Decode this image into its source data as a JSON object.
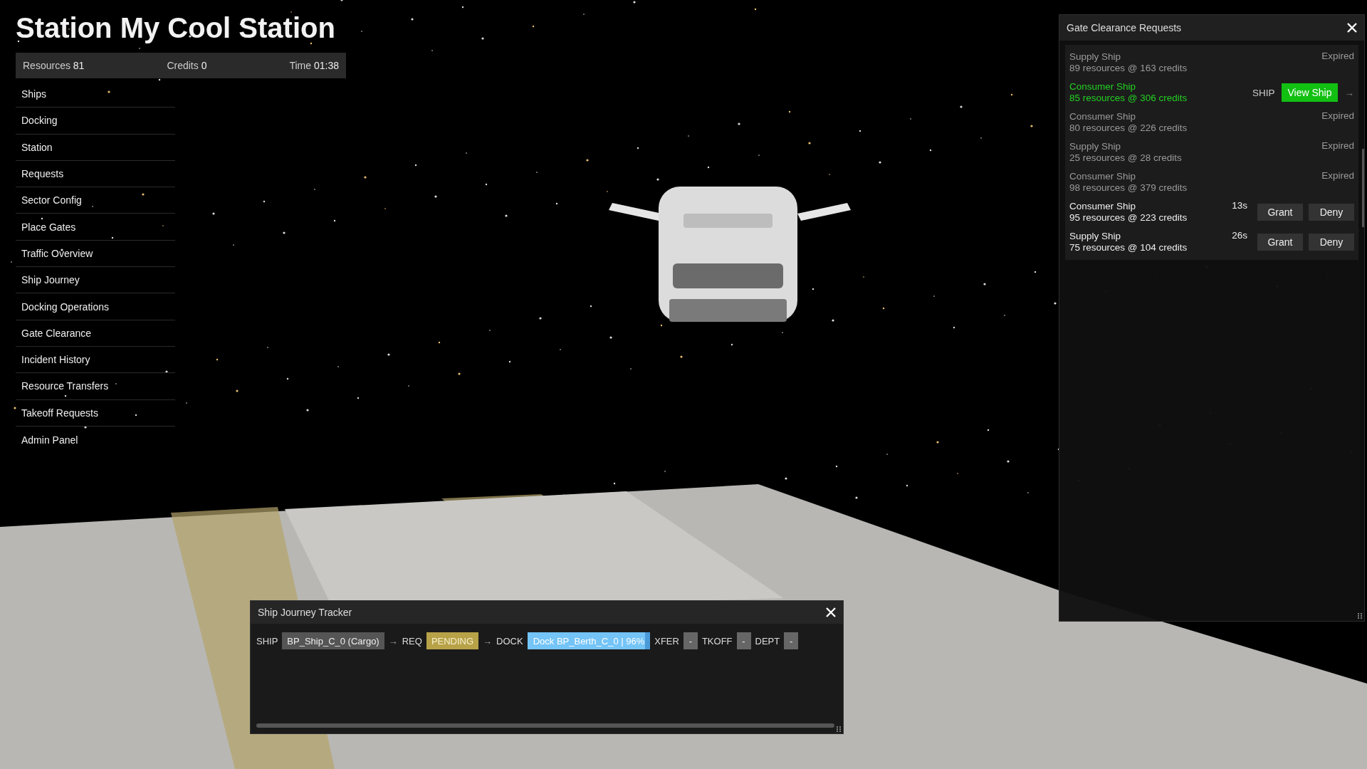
{
  "hud": {
    "title": "Station My Cool Station",
    "stats": [
      {
        "label": "Resources",
        "value": "81"
      },
      {
        "label": "Credits",
        "value": "0"
      },
      {
        "label": "Time",
        "value": "01:38"
      }
    ]
  },
  "menu": {
    "items": [
      "Ships",
      "Docking",
      "Station",
      "Requests",
      "Sector Config",
      "Place Gates",
      "Traffic Overview",
      "Ship Journey",
      "Docking Operations",
      "Gate Clearance",
      "Incident History",
      "Resource Transfers",
      "Takeoff Requests",
      "Admin Panel"
    ]
  },
  "gate_clearance": {
    "title": "Gate Clearance Requests",
    "requests": [
      {
        "kind": "expired",
        "ship": "Supply Ship",
        "detail": "89 resources @ 163 credits",
        "status": "Expired"
      },
      {
        "kind": "viewing",
        "ship": "Consumer Ship",
        "detail": "85 resources @ 306 credits",
        "tag": "SHIP",
        "button": "View Ship",
        "arrow": "→"
      },
      {
        "kind": "expired",
        "ship": "Consumer Ship",
        "detail": "80 resources @ 226 credits",
        "status": "Expired"
      },
      {
        "kind": "expired",
        "ship": "Supply Ship",
        "detail": "25 resources @ 28 credits",
        "status": "Expired"
      },
      {
        "kind": "expired",
        "ship": "Consumer Ship",
        "detail": "98 resources @ 379 credits",
        "status": "Expired"
      },
      {
        "kind": "pending",
        "ship": "Consumer Ship",
        "detail": "95 resources @ 223 credits",
        "timer": "13s",
        "grant": "Grant",
        "deny": "Deny"
      },
      {
        "kind": "pending",
        "ship": "Supply Ship",
        "detail": "75 resources @ 104 credits",
        "timer": "26s",
        "grant": "Grant",
        "deny": "Deny"
      }
    ]
  },
  "journey_tracker": {
    "title": "Ship Journey Tracker",
    "stages": [
      {
        "label": "SHIP",
        "kind": "neutral",
        "value": "BP_Ship_C_0 (Cargo)",
        "arrow": "→"
      },
      {
        "label": "REQ",
        "kind": "pending",
        "value": "PENDING",
        "arrow": "→"
      },
      {
        "label": "DOCK",
        "kind": "progress",
        "value": "Dock BP_Berth_C_0 | 96%",
        "level": 0.96
      },
      {
        "label": "XFER",
        "kind": "empty",
        "value": "-"
      },
      {
        "label": "TKOFF",
        "kind": "empty",
        "value": "-"
      },
      {
        "label": "DEPT",
        "kind": "empty",
        "value": "-"
      }
    ]
  }
}
